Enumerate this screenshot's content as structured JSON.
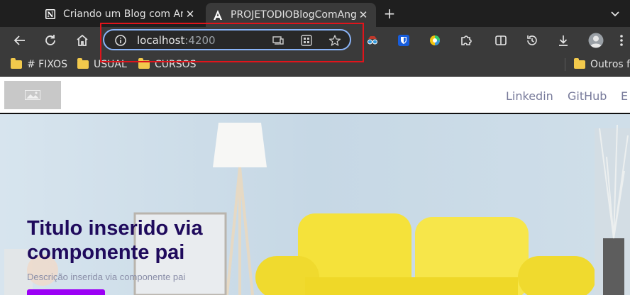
{
  "browser": {
    "tabs": [
      {
        "title": "Criando um Blog com Angular",
        "icon": "notion-icon",
        "active": false
      },
      {
        "title": "PROJETODIOBlogComAngular",
        "icon": "angular-icon",
        "active": true
      }
    ],
    "address": {
      "host": "localhost",
      "port": ":4200"
    },
    "extensions": [
      "spy-glasses-icon",
      "bitwarden-shield-icon",
      "color-picker-icon",
      "puzzle-extensions-icon"
    ],
    "bookmarks": [
      {
        "label": "# FIXOS"
      },
      {
        "label": "USUAL"
      },
      {
        "label": "CURSOS"
      },
      {
        "label": "Outros f"
      }
    ],
    "accent": "#8ab4f8",
    "highlight_color": "#e0141b"
  },
  "site": {
    "nav": [
      {
        "label": "Linkedin"
      },
      {
        "label": "GitHub"
      },
      {
        "label": "E"
      }
    ],
    "hero": {
      "title": "Titulo inserido via componente pai",
      "description": "Descrição inserida via componente pai",
      "title_color": "#1f0a5c",
      "button_color": "#9b00f5"
    }
  }
}
